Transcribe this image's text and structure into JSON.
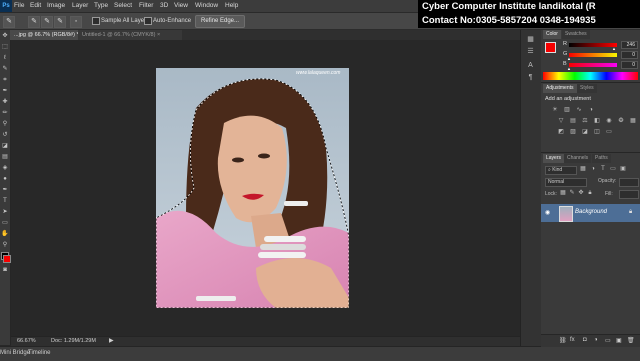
{
  "app": {
    "logo": "Ps"
  },
  "menu": [
    "File",
    "Edit",
    "Image",
    "Layer",
    "Type",
    "Select",
    "Filter",
    "3D",
    "View",
    "Window",
    "Help"
  ],
  "options": {
    "sample_all_layers": "Sample All Layers",
    "auto_enhance": "Auto-Enhance",
    "refine_edge": "Refine Edge..."
  },
  "tabs": [
    {
      "label": "...jpg @ 66.7% (RGB/8#) *",
      "close": "×"
    },
    {
      "label": "Untitled-1 @ 66.7% (CMYK/8)",
      "close": "×"
    }
  ],
  "photo": {
    "watermark_text": "www.lalaqueen.com"
  },
  "status": {
    "zoom": "66.67%",
    "doc": "Doc: 1.29M/1.29M"
  },
  "bottom": {
    "left_tab": "Mini Bridge",
    "timeline": "Timeline"
  },
  "overlay": {
    "line1": "Cyber Computer Institute landikotal (R",
    "line2": "Contact No:0305-5857204 0348-194935"
  },
  "color_panel": {
    "tabs": [
      "Color",
      "Swatches"
    ],
    "sliders": [
      {
        "label": "R",
        "value": "246"
      },
      {
        "label": "G",
        "value": "0"
      },
      {
        "label": "B",
        "value": "0"
      }
    ],
    "foreground": "#f60000",
    "background": "#ffffff"
  },
  "adjustments": {
    "tabs": [
      "Adjustments",
      "Styles"
    ],
    "title": "Add an adjustment"
  },
  "layers": {
    "tabs": [
      "Layers",
      "Channels",
      "Paths"
    ],
    "kind": "Kind",
    "blend": "Normal",
    "opacity_label": "Opacity:",
    "lock_label": "Lock:",
    "fill_label": "Fill:",
    "layer_name": "Background"
  },
  "colors": {
    "accent_blue": "#4a90e2",
    "selection": "#ffffff"
  }
}
